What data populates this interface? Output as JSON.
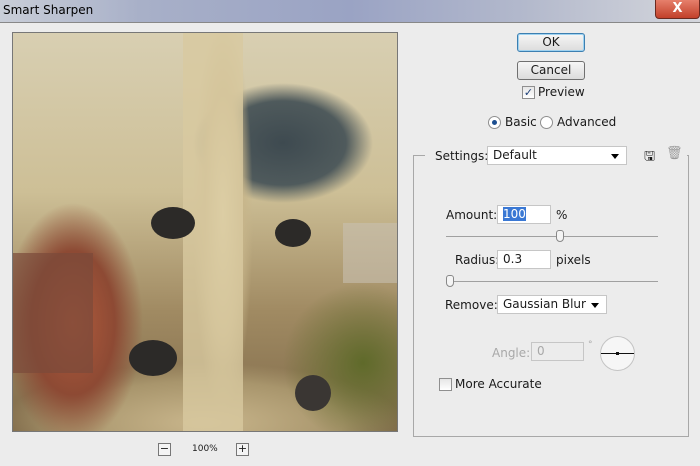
{
  "window": {
    "title": "Smart Sharpen",
    "close_label": "X"
  },
  "buttons": {
    "ok": "OK",
    "cancel": "Cancel"
  },
  "preview": {
    "label": "Preview",
    "checked": true
  },
  "mode": {
    "basic": "Basic",
    "advanced": "Advanced",
    "selected": "Basic"
  },
  "settings": {
    "label": "Settings:",
    "value": "Default"
  },
  "amount": {
    "label": "Amount:",
    "value": "100",
    "unit": "%",
    "slider_fraction": 0.54
  },
  "radius": {
    "label": "Radius:",
    "value": "0.3",
    "unit": "pixels",
    "slider_fraction": 0.02
  },
  "remove": {
    "label": "Remove:",
    "value": "Gaussian Blur"
  },
  "angle": {
    "label": "Angle:",
    "value": "0",
    "unit": "°"
  },
  "more_accurate": {
    "label": "More Accurate",
    "checked": false
  },
  "zoom": {
    "minus": "−",
    "level": "100%",
    "plus": "+"
  }
}
